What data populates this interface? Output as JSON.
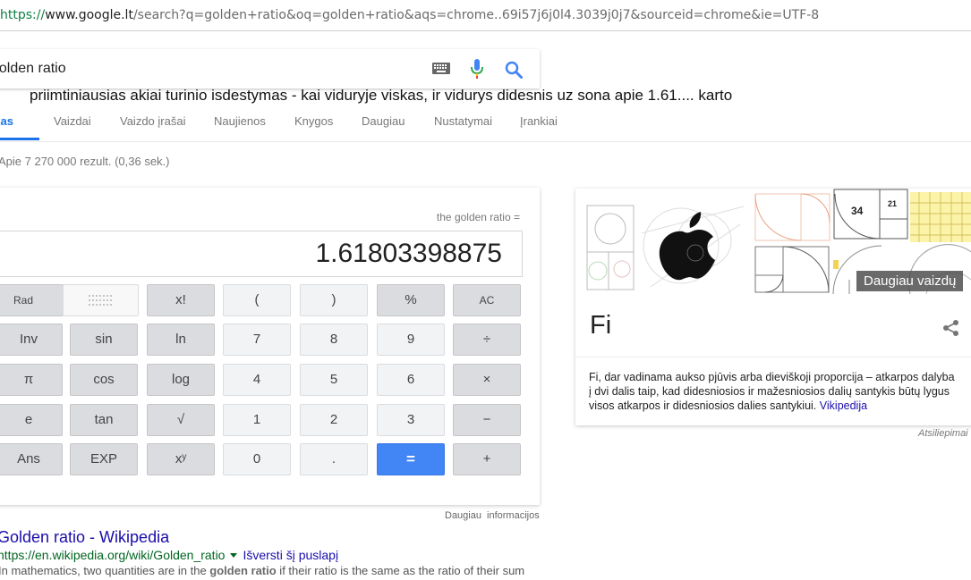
{
  "browser": {
    "url_scheme": "https://",
    "url_host": "www.google.lt",
    "url_rest": "/search?q=golden+ratio&oq=golden+ratio&aqs=chrome..69i57j6j0l4.3039j0j7&sourceid=chrome&ie=UTF-8"
  },
  "search": {
    "query": "golden ratio"
  },
  "annotation": "priimtiniausias akiai turinio isdestymas - kai viduryje viskas, ir vidurys didesnis uz sona apie 1.61.... karto",
  "tabs": [
    {
      "label": "Viskas",
      "active": true
    },
    {
      "label": "Vaizdai"
    },
    {
      "label": "Vaizdo įrašai"
    },
    {
      "label": "Naujienos"
    },
    {
      "label": "Knygos"
    },
    {
      "label": "Daugiau"
    },
    {
      "label": "Nustatymai"
    },
    {
      "label": "Įrankiai"
    }
  ],
  "result_stats": "Apie 7 270 000 rezult. (0,36 sek.)",
  "calculator": {
    "caption": "the golden ratio =",
    "value": "1.61803398875",
    "keys": {
      "rad": "Rad",
      "fact": "x!",
      "lparen": "(",
      "rparen": ")",
      "percent": "%",
      "ac": "AC",
      "inv": "Inv",
      "sin": "sin",
      "ln": "ln",
      "seven": "7",
      "eight": "8",
      "nine": "9",
      "divide": "÷",
      "pi": "π",
      "cos": "cos",
      "log": "log",
      "four": "4",
      "five": "5",
      "six": "6",
      "multiply": "×",
      "e": "e",
      "tan": "tan",
      "sqrt": "√",
      "one": "1",
      "two": "2",
      "three": "3",
      "minus": "−",
      "ans": "Ans",
      "exp": "EXP",
      "pow": "xʸ",
      "zero": "0",
      "dot": ".",
      "equals": "=",
      "plus": "+"
    },
    "more_info": "Daugiau informacijos"
  },
  "wiki_result": {
    "title": "Golden ratio - Wikipedia",
    "url": "https://en.wikipedia.org/wiki/Golden_ratio",
    "translate": "Išversti šį puslapį",
    "snippet_pre": "In mathematics, two quantities are in the ",
    "snippet_bold": "golden ratio",
    "snippet_post": " if their ratio is the same as the ratio of their sum"
  },
  "knowledge_panel": {
    "title": "Fi",
    "more_images": "Daugiau vaizdų",
    "image_labels": {
      "n34": "34",
      "n21": "21"
    },
    "description": "Fi, dar vadinama aukso pjūvis arba dieviškoji proporcija – atkarpos dalyba į dvi dalis taip, kad didesniosios ir mažesniosios dalių santykis būtų lygus visos atkarpos ir didesniosios dalies santykiui.",
    "source_link": "Vikipedija",
    "feedback": "Atsiliepimai"
  },
  "colors": {
    "accent": "#1a73e8",
    "link": "#1a0dab",
    "url_green": "#006621",
    "equals_key": "#4285f4"
  }
}
